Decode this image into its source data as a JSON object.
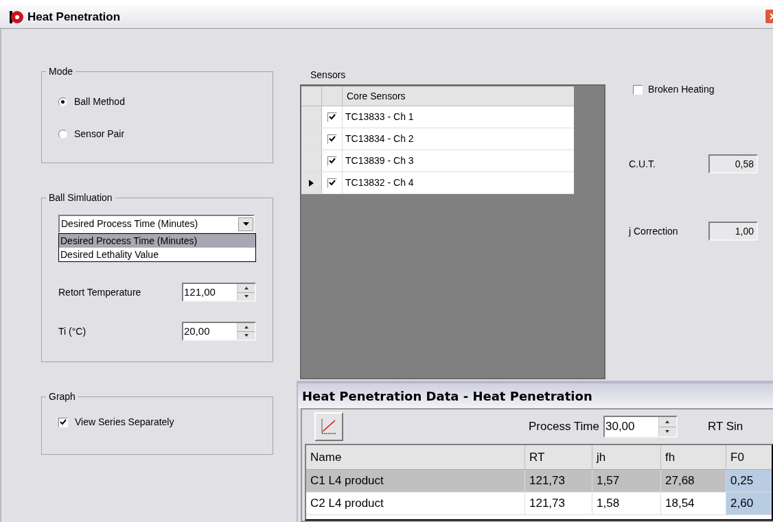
{
  "window": {
    "title": "Heat Penetration"
  },
  "mode": {
    "title": "Mode",
    "options": [
      {
        "label": "Ball Method",
        "selected": true
      },
      {
        "label": "Sensor Pair",
        "selected": false
      }
    ]
  },
  "ball_simulation": {
    "title": "Ball Simluation",
    "dropdown": {
      "value": "Desired Process Time (Minutes)",
      "expanded": true,
      "options": [
        {
          "label": "Desired Process Time (Minutes)",
          "selected": true
        },
        {
          "label": "Desired Lethality Value",
          "selected": false
        }
      ]
    },
    "fields": [
      {
        "label": "Retort Temperature",
        "value": "121,00"
      },
      {
        "label": "Ti (°C)",
        "value": "20,00"
      }
    ]
  },
  "graph": {
    "title": "Graph",
    "checkbox": {
      "label": "View Series Separately",
      "checked": true
    }
  },
  "sensors": {
    "label": "Sensors",
    "column": "Core Sensors",
    "rows": [
      {
        "name": "TC13833 - Ch 1",
        "checked": true,
        "current": false
      },
      {
        "name": "TC13834 - Ch 2",
        "checked": true,
        "current": false
      },
      {
        "name": "TC13839 - Ch 3",
        "checked": true,
        "current": false
      },
      {
        "name": "TC13832 - Ch 4",
        "checked": true,
        "current": true
      }
    ]
  },
  "broken_heating": {
    "label": "Broken Heating",
    "checked": false
  },
  "readouts": [
    {
      "label": "C.U.T.",
      "value": "0,58"
    },
    {
      "label": "j Correction",
      "value": "1,00"
    }
  ],
  "data_window": {
    "title": "Heat Penetration Data - Heat Penetration",
    "process_time": {
      "label": "Process Time",
      "value": "30,00"
    },
    "cut_label": "RT Sin",
    "columns": [
      "Name",
      "RT",
      "jh",
      "fh",
      "F0"
    ],
    "rows": [
      {
        "cells": [
          "C1 L4 product",
          "121,73",
          "1,57",
          "27,68",
          "0,25"
        ],
        "selected": true
      },
      {
        "cells": [
          "C2 L4 product",
          "121,73",
          "1,58",
          "18,54",
          "2,60"
        ],
        "selected": false
      }
    ]
  }
}
